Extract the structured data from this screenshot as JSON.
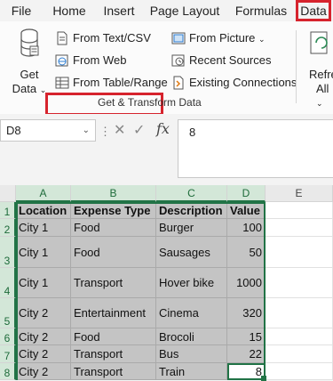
{
  "menu_tabs": [
    "File",
    "Home",
    "Insert",
    "Page Layout",
    "Formulas",
    "Data"
  ],
  "ribbon": {
    "get_data": {
      "label_line1": "Get",
      "label_line2": "Data"
    },
    "commands": {
      "from_text_csv": "From Text/CSV",
      "from_web": "From Web",
      "from_table_range": "From Table/Range",
      "from_picture": "From Picture",
      "recent_sources": "Recent Sources",
      "existing_connections": "Existing Connections"
    },
    "group_label": "Get & Transform Data",
    "refresh": {
      "label_line1": "Refre",
      "label_line2": "All"
    }
  },
  "formula_bar": {
    "name_box": "D8",
    "fx_symbol": "fx",
    "value": "8",
    "dots": "⋮"
  },
  "sheet": {
    "col_headers": [
      "A",
      "B",
      "C",
      "D",
      "E"
    ],
    "row_numbers": [
      "1",
      "2",
      "3",
      "4",
      "5",
      "6",
      "7",
      "8"
    ],
    "rows": [
      [
        "Location",
        "Expense Type",
        "Description",
        "Value"
      ],
      [
        "City 1",
        "Food",
        "Burger",
        "100"
      ],
      [
        "City 1",
        "Food",
        "Sausages",
        "50"
      ],
      [
        "City 1",
        "Transport",
        "Hover bike",
        "1000"
      ],
      [
        "City 2",
        "Entertainment",
        "Cinema",
        "320"
      ],
      [
        "City 2",
        "Food",
        "Brocoli",
        "15"
      ],
      [
        "City 2",
        "Transport",
        "Bus",
        "22"
      ],
      [
        "City 2",
        "Transport",
        "Train",
        "8"
      ]
    ]
  },
  "colors": {
    "highlight": "#d6232d",
    "excel_green": "#217346",
    "selection_fill": "#c4c4c4"
  }
}
